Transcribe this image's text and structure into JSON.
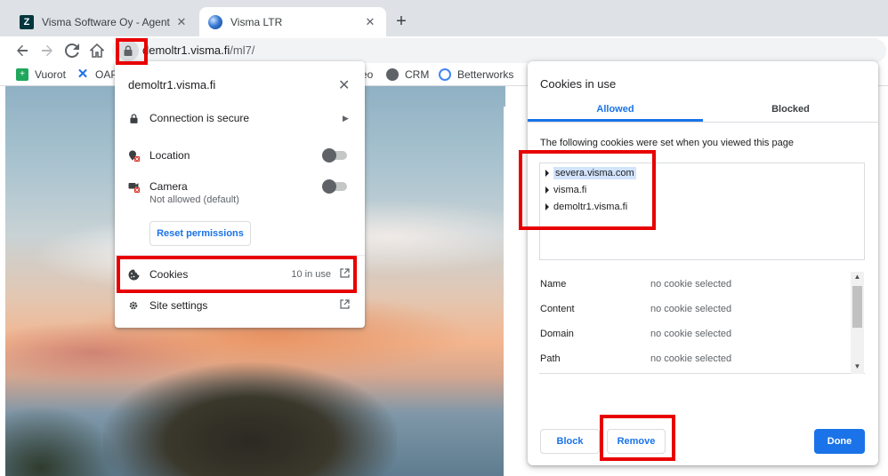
{
  "tabs": [
    {
      "title": "Visma Software Oy - Agent",
      "favicon": "zendesk-icon",
      "active": false
    },
    {
      "title": "Visma LTR",
      "favicon": "globe-icon",
      "active": true
    }
  ],
  "toolbar": {
    "url_host": "demoltr1.visma.fi",
    "url_path": "/ml7/"
  },
  "bookmarks": [
    {
      "label": "Vuorot",
      "icon": "plus-square-icon"
    },
    {
      "label": "OAP",
      "icon": "confluence-icon"
    },
    {
      "label": "eo",
      "icon": ""
    },
    {
      "label": "CRM",
      "icon": "globe-icon"
    },
    {
      "label": "Betterworks",
      "icon": "betterworks-icon"
    }
  ],
  "site_info": {
    "host": "demoltr1.visma.fi",
    "connection": "Connection is secure",
    "location": "Location",
    "camera": "Camera",
    "camera_sub": "Not allowed (default)",
    "reset": "Reset permissions",
    "cookies": "Cookies",
    "cookies_count": "10 in use",
    "site_settings": "Site settings"
  },
  "cookies_dialog": {
    "title": "Cookies in use",
    "tabs": {
      "allowed": "Allowed",
      "blocked": "Blocked"
    },
    "description": "The following cookies were set when you viewed this page",
    "domains": [
      "severa.visma.com",
      "visma.fi",
      "demoltr1.visma.fi"
    ],
    "details": [
      {
        "label": "Name",
        "value": "no cookie selected"
      },
      {
        "label": "Content",
        "value": "no cookie selected"
      },
      {
        "label": "Domain",
        "value": "no cookie selected"
      },
      {
        "label": "Path",
        "value": "no cookie selected"
      }
    ],
    "buttons": {
      "block": "Block",
      "remove": "Remove",
      "done": "Done"
    }
  },
  "colors": {
    "accent": "#1a73e8",
    "highlight": "#e80000"
  }
}
